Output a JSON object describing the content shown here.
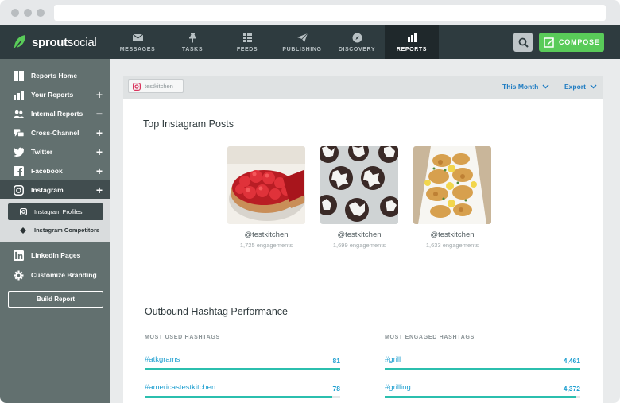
{
  "brand": {
    "name_bold": "sprout",
    "name_light": "social",
    "accent": "#59cb59"
  },
  "nav": {
    "items": [
      {
        "label": "MESSAGES",
        "icon": "envelope-icon"
      },
      {
        "label": "TASKS",
        "icon": "pin-icon"
      },
      {
        "label": "FEEDS",
        "icon": "list-icon"
      },
      {
        "label": "PUBLISHING",
        "icon": "paper-plane-icon"
      },
      {
        "label": "DISCOVERY",
        "icon": "compass-icon"
      },
      {
        "label": "REPORTS",
        "icon": "bar-chart-icon",
        "active": true
      }
    ],
    "compose_label": "COMPOSE"
  },
  "sidebar": {
    "items": [
      {
        "label": "Reports Home",
        "icon": "grid-icon",
        "plus": ""
      },
      {
        "label": "Your Reports",
        "icon": "bar-chart-icon",
        "plus": "+"
      },
      {
        "label": "Internal Reports",
        "icon": "users-icon",
        "plus": "−"
      },
      {
        "label": "Cross-Channel",
        "icon": "chat-icon",
        "plus": "+"
      },
      {
        "label": "Twitter",
        "icon": "twitter-icon",
        "plus": "+"
      },
      {
        "label": "Facebook",
        "icon": "facebook-icon",
        "plus": "+"
      },
      {
        "label": "Instagram",
        "icon": "instagram-icon",
        "plus": "+"
      },
      {
        "label": "LinkedIn Pages",
        "icon": "linkedin-icon",
        "plus": ""
      },
      {
        "label": "Customize Branding",
        "icon": "gear-icon",
        "plus": ""
      }
    ],
    "subitems": [
      {
        "label": "Instagram Profiles",
        "icon": "instagram-icon"
      },
      {
        "label": "Instagram Competitors",
        "icon": "diamond-icon"
      }
    ],
    "build_report_label": "Build Report"
  },
  "toolbar": {
    "profile": "testkitchen",
    "date_range": "This Month",
    "export_label": "Export"
  },
  "top_posts": {
    "title": "Top Instagram Posts",
    "posts": [
      {
        "handle": "@testkitchen",
        "engagements": "1,725 engagements",
        "image": "strawberry-pie"
      },
      {
        "handle": "@testkitchen",
        "engagements": "1,699 engagements",
        "image": "crinkle-cookies"
      },
      {
        "handle": "@testkitchen",
        "engagements": "1,633 engagements",
        "image": "chicken-piccata"
      }
    ]
  },
  "hashtags": {
    "title": "Outbound Hashtag Performance",
    "most_used": {
      "heading": "MOST USED HASHTAGS",
      "rows": [
        {
          "tag": "#atkgrams",
          "count": "81",
          "fraction": 1.0
        },
        {
          "tag": "#americastestkitchen",
          "count": "78",
          "fraction": 0.96
        }
      ]
    },
    "most_engaged": {
      "heading": "MOST ENGAGED HASHTAGS",
      "rows": [
        {
          "tag": "#grill",
          "count": "4,461",
          "fraction": 1.0
        },
        {
          "tag": "#grilling",
          "count": "4,372",
          "fraction": 0.98
        }
      ]
    }
  }
}
